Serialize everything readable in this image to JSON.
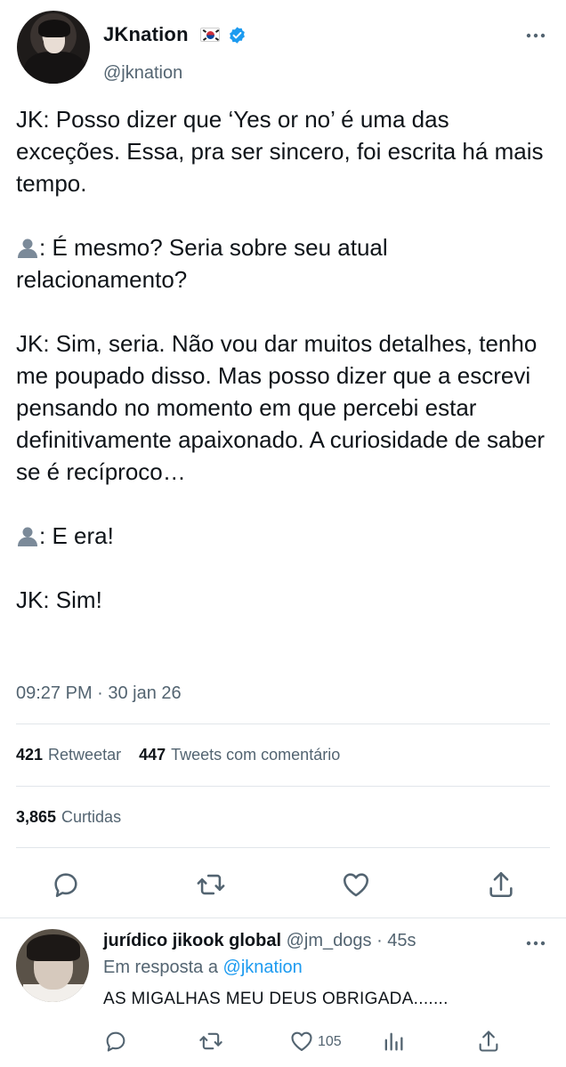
{
  "author": {
    "display_name": "JKnation",
    "flag": "south-korea-flag",
    "verified": true,
    "handle": "@jknation"
  },
  "tweet": {
    "lines": [
      "JK: Posso dizer que ‘Yes or no’ é uma das exceções. Essa, pra ser sincero, foi escrita há mais tempo.",
      ": É mesmo? Seria sobre seu atual relacionamento?",
      "JK: Sim, seria. Não vou dar muitos detalhes, tenho me poupado disso. Mas posso dizer que a escrevi pensando no momento em que percebi estar definitivamente apaixonado. A curiosidade de saber se é recíproco…",
      ": E era!",
      "JK: Sim!"
    ],
    "timestamp": "09:27 PM · 30 jan 26"
  },
  "stats": {
    "retweets_count": "421",
    "retweets_label": "Retweetar",
    "quotes_count": "447",
    "quotes_label": "Tweets com comentário",
    "likes_count": "3,865",
    "likes_label": "Curtidas"
  },
  "reply": {
    "name": "jurídico jikook global",
    "handle": "@jm_dogs",
    "time": "· 45s",
    "in_reply_prefix": "Em resposta a",
    "in_reply_mention": "@jknation",
    "text": "AS MIGALHAS MEU DEUS OBRIGADA.......",
    "like_count": "105"
  },
  "colors": {
    "accent": "#1d9bf0",
    "text_secondary": "#536471",
    "icon": "#536471"
  }
}
